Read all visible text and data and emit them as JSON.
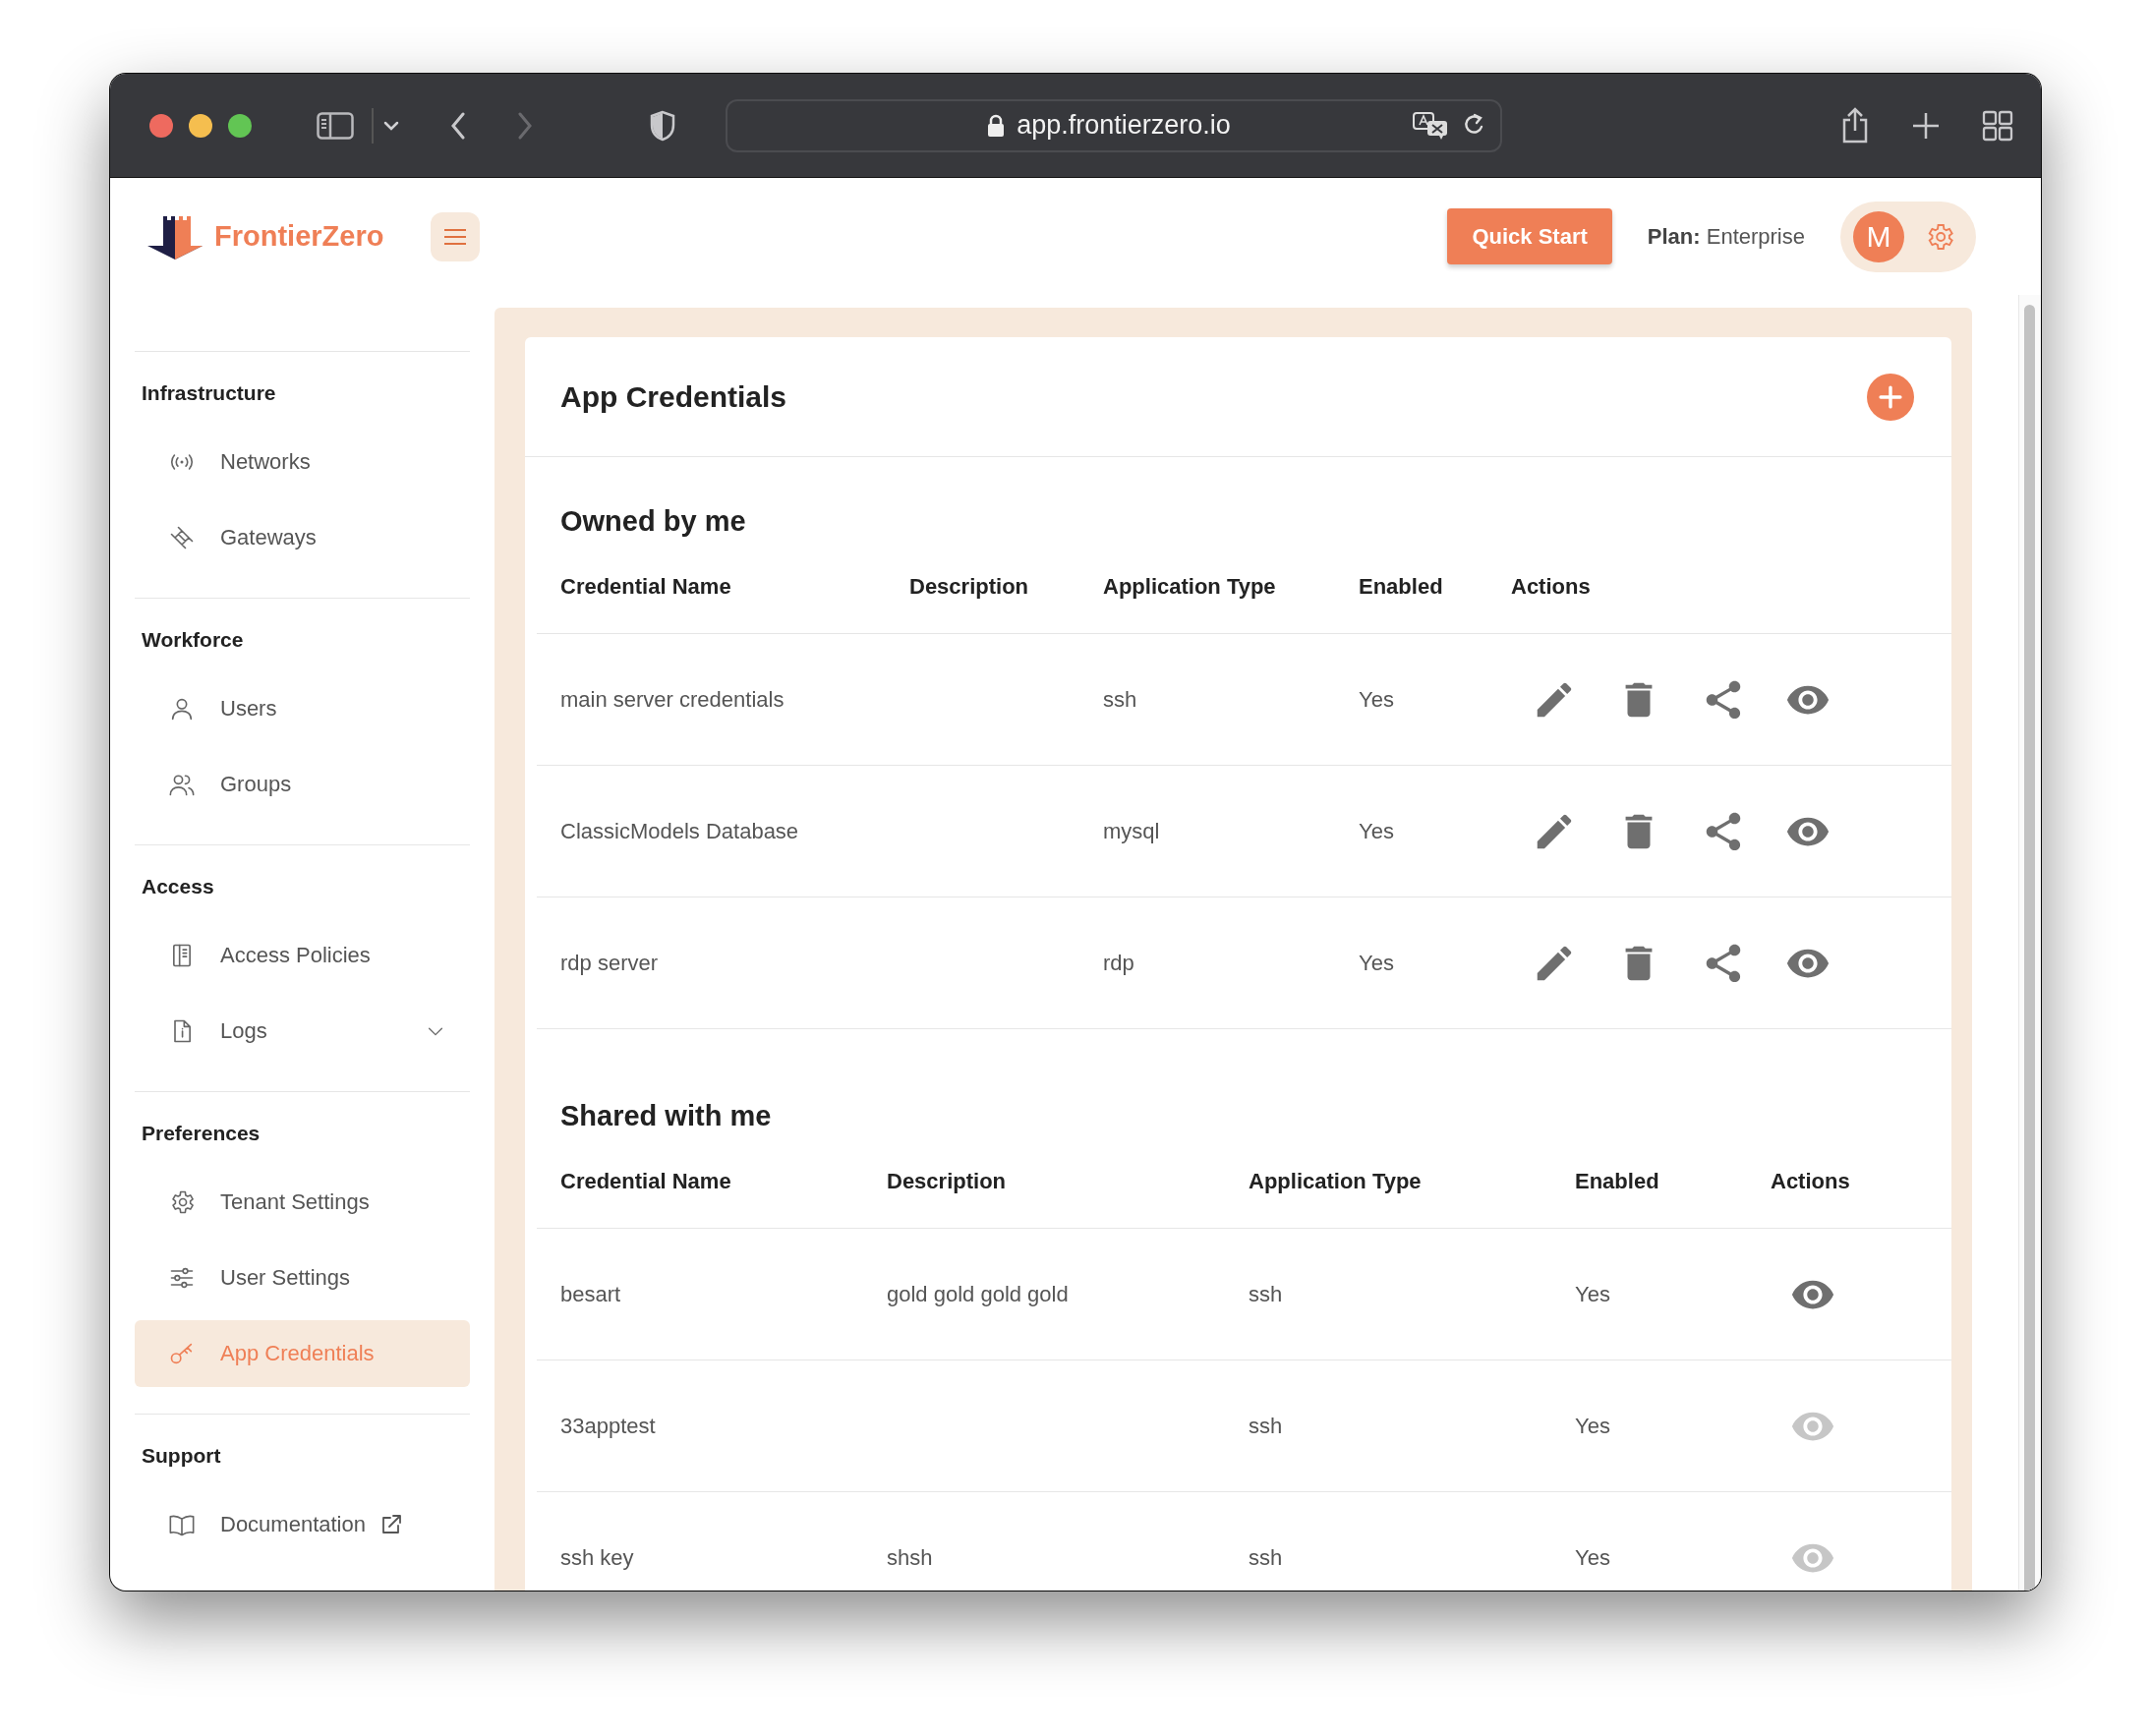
{
  "browser": {
    "url": "app.frontierzero.io"
  },
  "header": {
    "brand": "FrontierZero",
    "quick_start": "Quick Start",
    "plan": "**Plan:** Enterprise",
    "avatar_initial": "M"
  },
  "sidebar": {
    "sections": [
      {
        "title": "Infrastructure",
        "items": [
          {
            "label": "Networks",
            "selected": false
          },
          {
            "label": "Gateways",
            "selected": false
          }
        ]
      },
      {
        "title": "Workforce",
        "items": [
          {
            "label": "Users",
            "selected": false
          },
          {
            "label": "Groups",
            "selected": false
          }
        ]
      },
      {
        "title": "Access",
        "items": [
          {
            "label": "Access Policies",
            "selected": false
          },
          {
            "label": "Logs",
            "selected": false,
            "expanded": false
          }
        ]
      },
      {
        "title": "Preferences",
        "items": [
          {
            "label": "Tenant Settings",
            "selected": false
          },
          {
            "label": "User Settings",
            "selected": false
          },
          {
            "label": "App Credentials",
            "selected": true
          }
        ]
      },
      {
        "title": "Support",
        "items": [
          {
            "label": "Documentation",
            "selected": false,
            "external": true
          }
        ]
      }
    ]
  },
  "content": {
    "title": "App Credentials",
    "sections": [
      {
        "heading": "Owned by me",
        "columns": [
          "Credential Name",
          "Description",
          "Application Type",
          "Enabled",
          "Actions"
        ],
        "rows": [
          {
            "name": "main server credentials",
            "app_type": "ssh",
            "enabled": "Yes",
            "actions": [
              {
                "kind": "edit",
                "disabled": false
              },
              {
                "kind": "delete",
                "disabled": false
              },
              {
                "kind": "share",
                "disabled": false
              },
              {
                "kind": "view",
                "disabled": false
              }
            ]
          },
          {
            "name": "ClassicModels Database",
            "app_type": "mysql",
            "enabled": "Yes",
            "actions": [
              {
                "kind": "edit",
                "disabled": false
              },
              {
                "kind": "delete",
                "disabled": false
              },
              {
                "kind": "share",
                "disabled": false
              },
              {
                "kind": "view",
                "disabled": false
              }
            ]
          },
          {
            "name": "rdp server",
            "app_type": "rdp",
            "enabled": "Yes",
            "actions": [
              {
                "kind": "edit",
                "disabled": false
              },
              {
                "kind": "delete",
                "disabled": false
              },
              {
                "kind": "share",
                "disabled": false
              },
              {
                "kind": "view",
                "disabled": false
              }
            ]
          }
        ]
      },
      {
        "heading": "Shared with me",
        "columns": [
          "Credential Name",
          "Description",
          "Application Type",
          "Enabled",
          "Actions"
        ],
        "rows": [
          {
            "name": "besart",
            "description": "gold gold gold gold",
            "app_type": "ssh",
            "enabled": "Yes",
            "actions": [
              {
                "kind": "view",
                "disabled": false
              }
            ]
          },
          {
            "name": "33apptest",
            "app_type": "ssh",
            "enabled": "Yes",
            "actions": [
              {
                "kind": "view",
                "disabled": true
              }
            ]
          },
          {
            "name": "ssh key",
            "description": "shsh",
            "app_type": "ssh",
            "enabled": "Yes",
            "actions": [
              {
                "kind": "view",
                "disabled": true
              }
            ]
          }
        ]
      }
    ]
  }
}
